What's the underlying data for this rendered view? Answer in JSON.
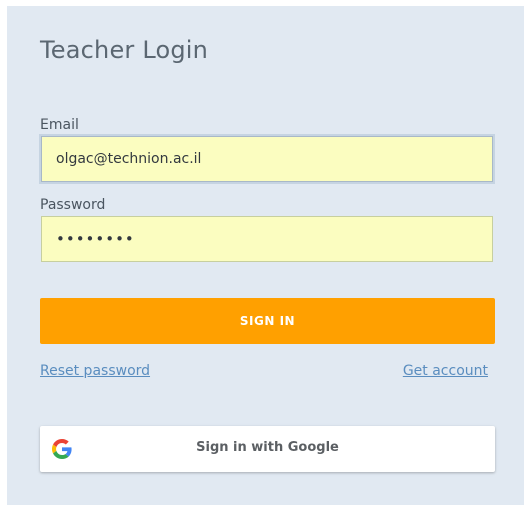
{
  "login": {
    "title": "Teacher Login",
    "email_label": "Email",
    "email_value": "olgac@technion.ac.il",
    "password_label": "Password",
    "password_value": "••••••••",
    "signin_label": "SIGN IN",
    "reset_label": "Reset password",
    "get_account_label": "Get account",
    "google_label": "Sign in with Google",
    "google_icon": "google-icon",
    "colors": {
      "background": "#e1e9f2",
      "input_fill": "#fbfdc0",
      "signin": "#ffa000",
      "link": "#5a8dbf"
    }
  }
}
